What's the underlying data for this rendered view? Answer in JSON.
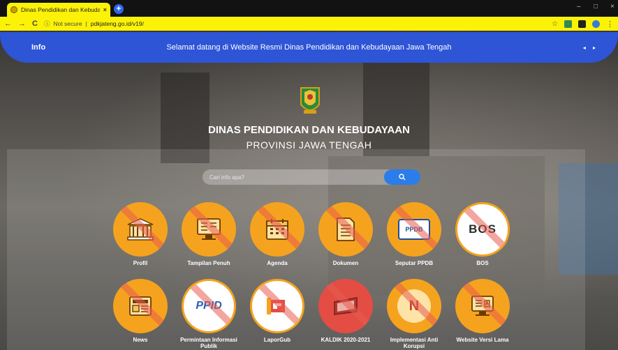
{
  "browser": {
    "tab_title": "Dinas Pendidikan dan Kebudayaan",
    "tab_close": "×",
    "new_tab": "+",
    "back": "←",
    "forward": "→",
    "reload": "C",
    "security_label": "Not secure",
    "url": "pdkjateng.go.id/v19/",
    "minimize": "–",
    "maximize": "□",
    "close": "×"
  },
  "infobar": {
    "label": "Info",
    "text": "Selamat datang di Website Resmi Dinas Pendidikan dan Kebudayaan Jawa Tengah",
    "arrows": "◂ ▸"
  },
  "header": {
    "title": "DINAS PENDIDIKAN DAN KEBUDAYAAN",
    "subtitle": "PROVINSI JAWA TENGAH"
  },
  "search": {
    "placeholder": "Cari info apa?",
    "button_icon": "search-icon"
  },
  "menu": [
    {
      "label": "Profil",
      "icon": "building-icon"
    },
    {
      "label": "Tampilan Penuh",
      "icon": "monitor-icon"
    },
    {
      "label": "Agenda",
      "icon": "calendar-icon"
    },
    {
      "label": "Dokumen",
      "icon": "document-icon"
    },
    {
      "label": "Seputar PPDB",
      "icon": "ppdb-logo-icon",
      "logo_text": "PPDB"
    },
    {
      "label": "BOS",
      "icon": "bos-logo-icon",
      "logo_text": "BOS"
    },
    {
      "label": "News",
      "icon": "newspaper-icon"
    },
    {
      "label": "Permintaan Informasi Publik",
      "icon": "ppid-logo-icon",
      "logo_text": "PPID"
    },
    {
      "label": "LaporGub",
      "icon": "laporgub-logo-icon"
    },
    {
      "label": "KALDIK 2020-2021",
      "icon": "kaldik-icon"
    },
    {
      "label": "Implementasi Anti Korupsi",
      "icon": "anti-korupsi-icon",
      "logo_text": "N"
    },
    {
      "label": "Website Versi Lama",
      "icon": "old-website-icon"
    }
  ],
  "colors": {
    "browser_accent": "#fbf208",
    "infobar": "#2d55d6",
    "menu_circle": "#f5a31e",
    "search_button": "#2b7de9"
  }
}
